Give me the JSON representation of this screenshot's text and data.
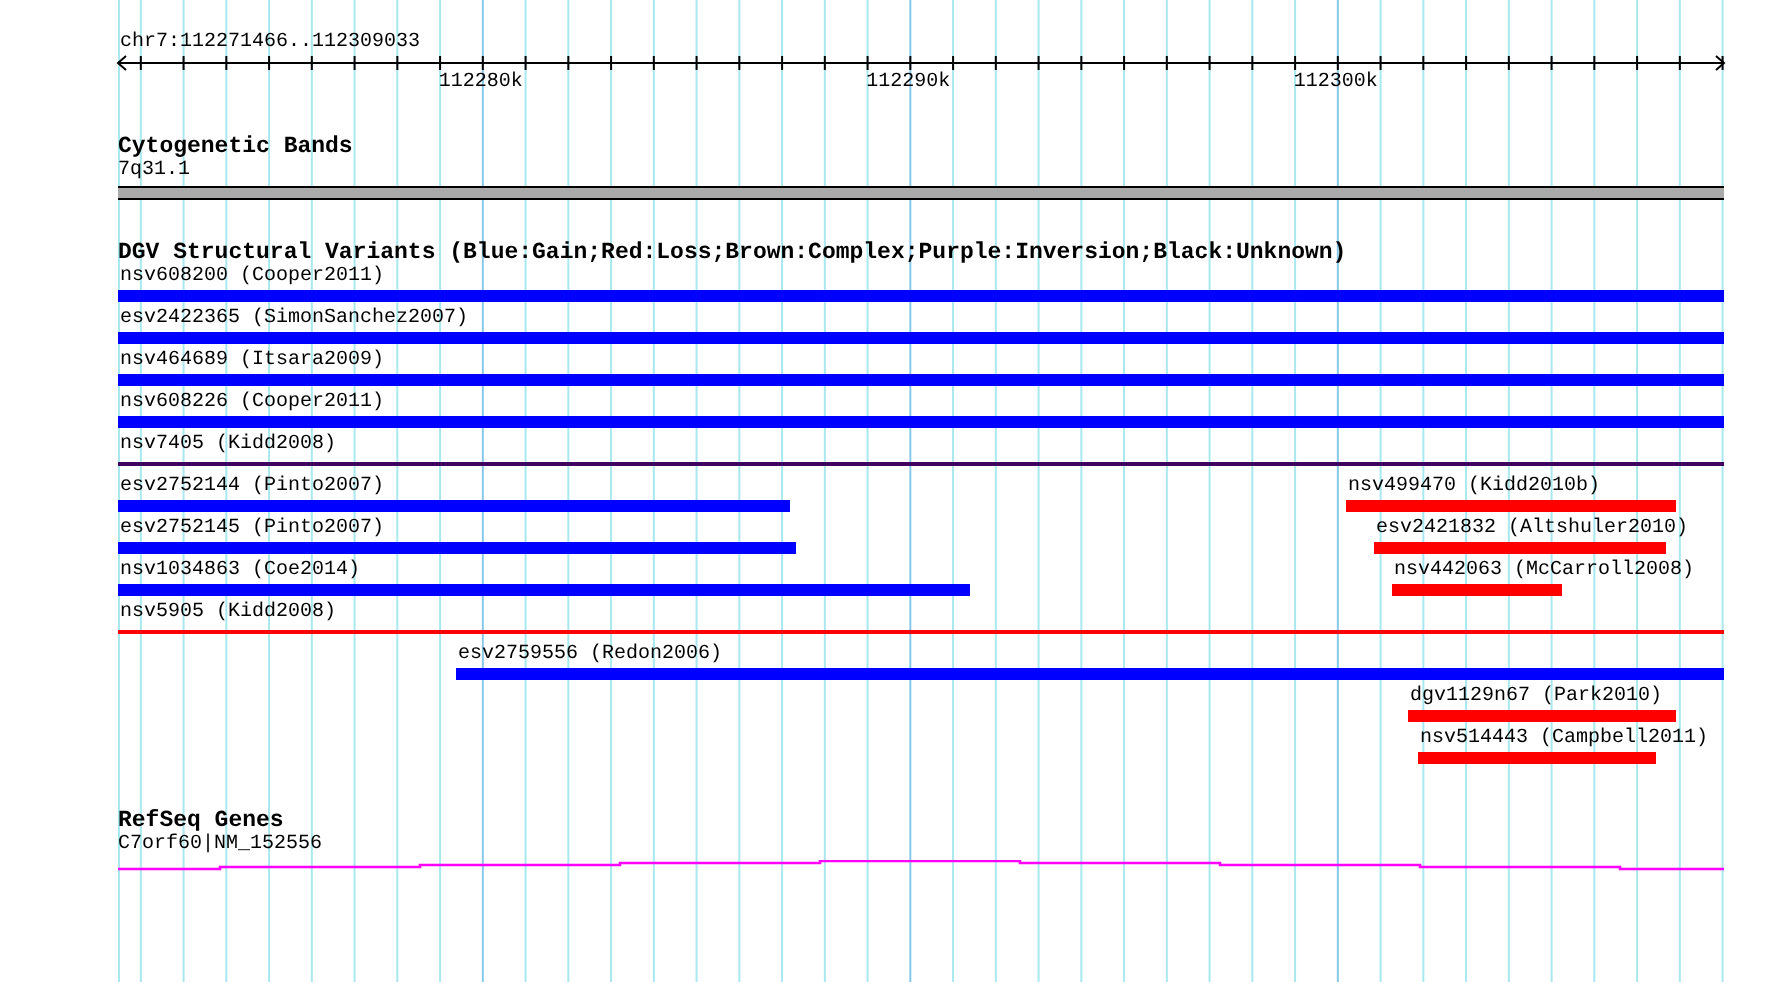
{
  "region": {
    "title": "chr7:112271466..112309033",
    "ruler_labels": [
      "112280k",
      "112290k",
      "112300k"
    ]
  },
  "cytogenetic": {
    "title": "Cytogenetic Bands",
    "band": "7q31.1"
  },
  "dgv": {
    "title": "DGV Structural Variants (Blue:Gain;Red:Loss;Brown:Complex;Purple:Inversion;Black:Unknown)",
    "rows": [
      {
        "features": [
          {
            "label": "nsv608200 (Cooper2011)",
            "color": "#0000ff",
            "kind": "bar"
          }
        ]
      },
      {
        "features": [
          {
            "label": "esv2422365 (SimonSanchez2007)",
            "color": "#0000ff",
            "kind": "bar"
          }
        ]
      },
      {
        "features": [
          {
            "label": "nsv464689 (Itsara2009)",
            "color": "#0000ff",
            "kind": "bar"
          }
        ]
      },
      {
        "features": [
          {
            "label": "nsv608226 (Cooper2011)",
            "color": "#0000ff",
            "kind": "bar"
          }
        ]
      },
      {
        "features": [
          {
            "label": "nsv7405 (Kidd2008)",
            "color": "#400060",
            "kind": "line"
          }
        ]
      },
      {
        "features": [
          {
            "label": "esv2752144 (Pinto2007)",
            "color": "#0000ff",
            "kind": "bar"
          },
          {
            "label": "nsv499470 (Kidd2010b)",
            "color": "#ff0000",
            "kind": "bar"
          }
        ]
      },
      {
        "features": [
          {
            "label": "esv2752145 (Pinto2007)",
            "color": "#0000ff",
            "kind": "bar"
          },
          {
            "label": "esv2421832 (Altshuler2010)",
            "color": "#ff0000",
            "kind": "bar"
          }
        ]
      },
      {
        "features": [
          {
            "label": "nsv1034863 (Coe2014)",
            "color": "#0000ff",
            "kind": "bar"
          },
          {
            "label": "nsv442063 (McCarroll2008)",
            "color": "#ff0000",
            "kind": "bar"
          }
        ]
      },
      {
        "features": [
          {
            "label": "nsv5905 (Kidd2008)",
            "color": "#ff0000",
            "kind": "line"
          }
        ]
      },
      {
        "features": [
          {
            "label": "esv2759556 (Redon2006)",
            "color": "#0000ff",
            "kind": "bar"
          }
        ]
      },
      {
        "features": [
          {
            "label": "dgv1129n67 (Park2010)",
            "color": "#ff0000",
            "kind": "bar"
          }
        ]
      },
      {
        "features": [
          {
            "label": "nsv514443 (Campbell2011)",
            "color": "#ff0000",
            "kind": "bar"
          }
        ]
      }
    ]
  },
  "refseq": {
    "title": "RefSeq Genes",
    "gene": "C7orf60|NM_152556"
  }
}
